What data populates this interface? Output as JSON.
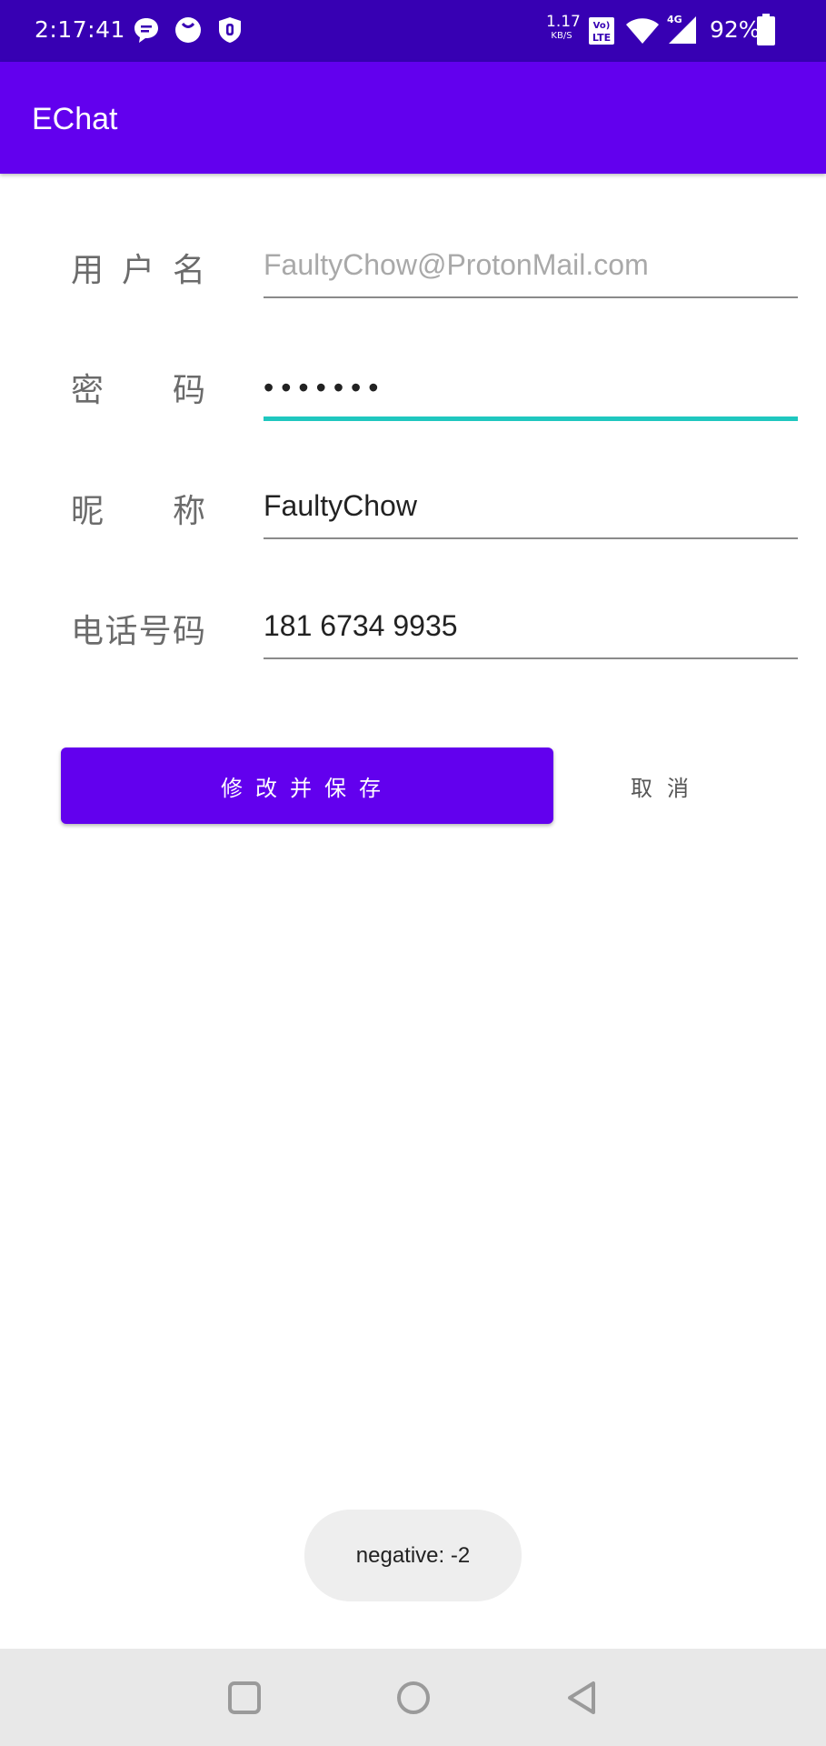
{
  "status_bar": {
    "time": "2:17:41",
    "net_speed_value": "1.17",
    "net_speed_unit": "KB/S",
    "volte": "Vo LTE",
    "network": "4G",
    "battery": "92%",
    "notification_icons": [
      "message-icon",
      "smiley-icon",
      "shield-icon"
    ]
  },
  "app_bar": {
    "title": "EChat"
  },
  "form": {
    "username": {
      "label": "用户名",
      "placeholder": "FaultyChow@ProtonMail.com",
      "value": ""
    },
    "password": {
      "label": "密码",
      "masked_value": "•••••••"
    },
    "nickname": {
      "label": "昵称",
      "value": "FaultyChow"
    },
    "phone": {
      "label": "电话号码",
      "value": "181 6734 9935"
    }
  },
  "buttons": {
    "save": "修改并保存",
    "cancel": "取消"
  },
  "toast": {
    "text": "negative: -2"
  },
  "colors": {
    "status_bar": "#3700b3",
    "primary": "#6200ee",
    "focus_underline": "#1fc7bf",
    "nav_bar": "#e8e8e8"
  },
  "nav_bar": {
    "icons": [
      "recents-square-icon",
      "home-circle-icon",
      "back-triangle-icon"
    ]
  }
}
